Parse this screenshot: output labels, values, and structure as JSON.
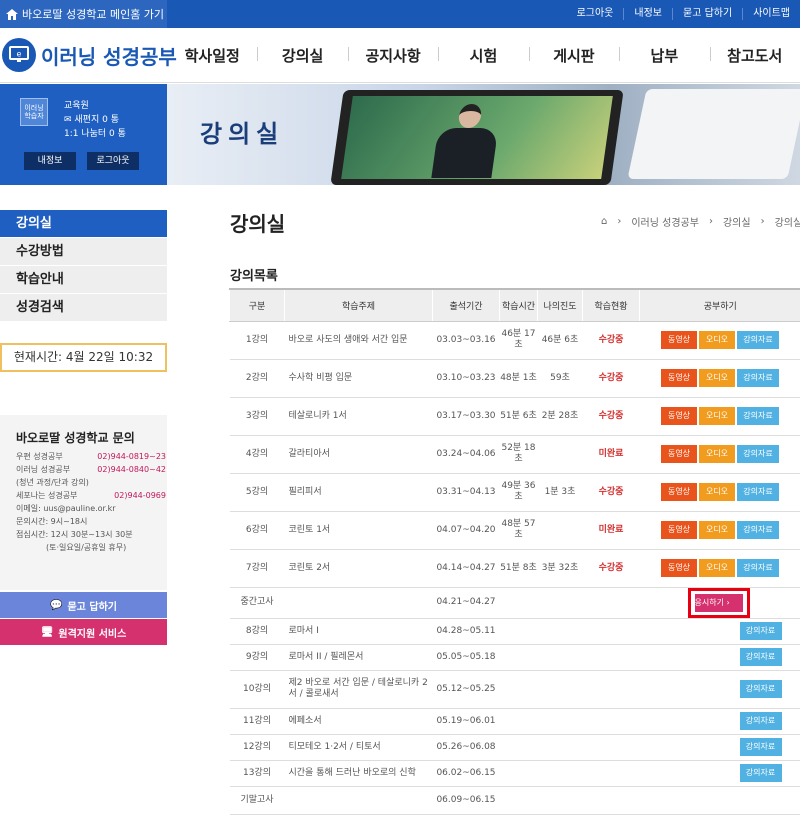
{
  "topbar": {
    "home_link": "바오로딸 성경학교 메인홈 가기",
    "links": [
      "로그아웃",
      "내정보",
      "묻고 답하기",
      "사이트맵"
    ]
  },
  "header": {
    "logo_text": "이러닝 성경공부",
    "nav": [
      "학사일정",
      "강의실",
      "공지사항",
      "시험",
      "게시판",
      "납부",
      "참고도서"
    ]
  },
  "user": {
    "badge": "이러닝 학습자",
    "name": "교육원",
    "mail": "새편지 0 통",
    "qna": "1:1 나눔터 0 통",
    "btn_info": "내정보",
    "btn_logout": "로그아웃"
  },
  "banner": {
    "title": "강의실"
  },
  "sidemenu": [
    "강의실",
    "수강방법",
    "학습안내",
    "성경검색"
  ],
  "clock": "현재시간: 4월 22일 10:32",
  "contact": {
    "title": "바오로딸 성경학교 문의",
    "rows": [
      {
        "label": "우편 성경공부",
        "phone": "02)944-0819~23"
      },
      {
        "label": "이러닝 성경공부",
        "phone": "02)944-0840~42"
      },
      {
        "label": "(청년 과정/단과 강의)",
        "phone": ""
      },
      {
        "label": "세포나는 성경공부",
        "phone": "02)944-0969"
      },
      {
        "label": "이메일: uus@pauline.or.kr",
        "phone": ""
      },
      {
        "label": "문의시간: 9시~18시",
        "phone": ""
      },
      {
        "label": "점심시간: 12시 30분~13시 30분",
        "phone": ""
      },
      {
        "label": "(토·일요일/공휴일 휴무)",
        "phone": ""
      }
    ],
    "btn_qna": "묻고 답하기",
    "btn_remote": "원격지원 서비스"
  },
  "main": {
    "title": "강의실",
    "breadcrumb": [
      "이러닝 성경공부",
      "강의실",
      "강의실"
    ],
    "list_title": "강의목록",
    "columns": [
      "구분",
      "학습주제",
      "출석기간",
      "학습시간",
      "나의진도",
      "학습현황",
      "공부하기"
    ],
    "buttons": {
      "video": "동영상",
      "audio": "오디오",
      "data": "강의자료",
      "exam": "응시하기 ›"
    },
    "rows": [
      {
        "no": "1강의",
        "subject": "바오로 사도의 생애와 서간 입문",
        "period": "03.03~03.16",
        "time": "46분 17초",
        "progress": "46분 6초",
        "status": "수강중",
        "kind": "full"
      },
      {
        "no": "2강의",
        "subject": "수사학 비평 입문",
        "period": "03.10~03.23",
        "time": "48분 1초",
        "progress": "59초",
        "status": "수강중",
        "kind": "full"
      },
      {
        "no": "3강의",
        "subject": "테살로니카 1서",
        "period": "03.17~03.30",
        "time": "51분 6초",
        "progress": "2분 28초",
        "status": "수강중",
        "kind": "full"
      },
      {
        "no": "4강의",
        "subject": "갈라티아서",
        "period": "03.24~04.06",
        "time": "52분 18초",
        "progress": "",
        "status": "미완료",
        "kind": "full"
      },
      {
        "no": "5강의",
        "subject": "필리피서",
        "period": "03.31~04.13",
        "time": "49분 36초",
        "progress": "1분 3초",
        "status": "수강중",
        "kind": "full"
      },
      {
        "no": "6강의",
        "subject": "코린토 1서",
        "period": "04.07~04.20",
        "time": "48분 57초",
        "progress": "",
        "status": "미완료",
        "kind": "full"
      },
      {
        "no": "7강의",
        "subject": "코린토 2서",
        "period": "04.14~04.27",
        "time": "51분 8초",
        "progress": "3분 32초",
        "status": "수강중",
        "kind": "full"
      },
      {
        "no": "중간고사",
        "subject": "",
        "period": "04.21~04.27",
        "time": "",
        "progress": "",
        "status": "",
        "kind": "exam"
      },
      {
        "no": "8강의",
        "subject": "로마서 I",
        "period": "04.28~05.11",
        "time": "",
        "progress": "",
        "status": "",
        "kind": "data"
      },
      {
        "no": "9강의",
        "subject": "로마서 II / 필레몬서",
        "period": "05.05~05.18",
        "time": "",
        "progress": "",
        "status": "",
        "kind": "data"
      },
      {
        "no": "10강의",
        "subject": "제2 바오로 서간 입문 / 테살로니카 2서 / 콜로새서",
        "period": "05.12~05.25",
        "time": "",
        "progress": "",
        "status": "",
        "kind": "data"
      },
      {
        "no": "11강의",
        "subject": "에페소서",
        "period": "05.19~06.01",
        "time": "",
        "progress": "",
        "status": "",
        "kind": "data"
      },
      {
        "no": "12강의",
        "subject": "티모테오 1·2서 / 티토서",
        "period": "05.26~06.08",
        "time": "",
        "progress": "",
        "status": "",
        "kind": "data"
      },
      {
        "no": "13강의",
        "subject": "시간을 통해 드러난 바오로의 신학",
        "period": "06.02~06.15",
        "time": "",
        "progress": "",
        "status": "",
        "kind": "data"
      },
      {
        "no": "기말고사",
        "subject": "",
        "period": "06.09~06.15",
        "time": "",
        "progress": "",
        "status": "",
        "kind": "none"
      }
    ]
  },
  "colors": {
    "brand": "#1a58b5",
    "video": "#e8541b",
    "audio": "#f29c1f",
    "data": "#50b1e2",
    "exam": "#d6316f",
    "status": "#d32f2f"
  }
}
